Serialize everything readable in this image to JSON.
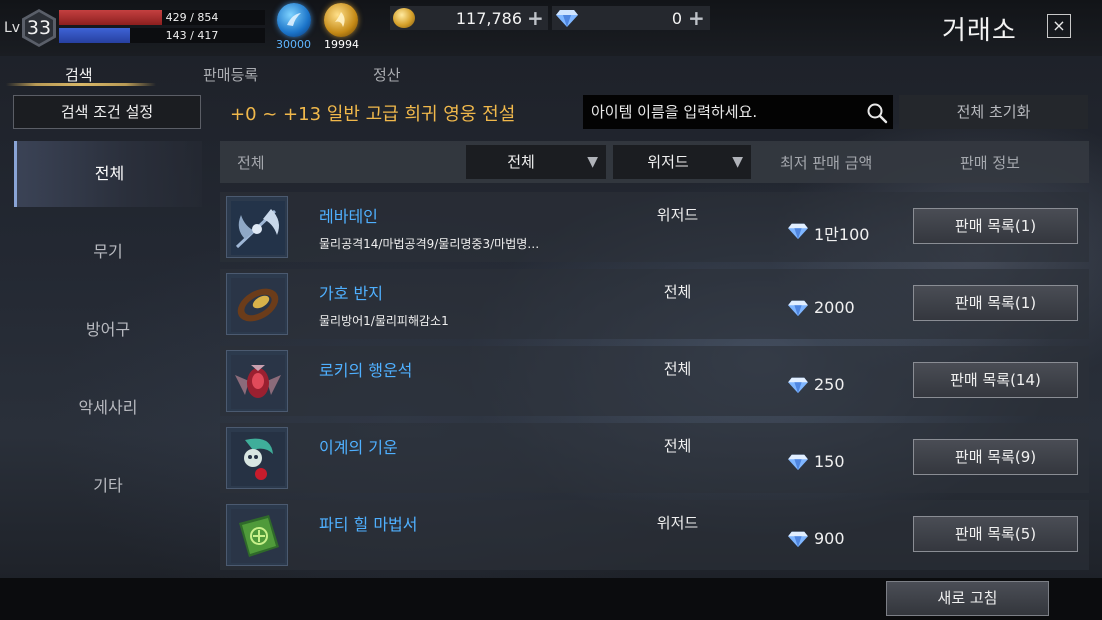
{
  "player": {
    "level_label": "Lv",
    "level": "33",
    "hp_text": "429 / 854",
    "hp_fraction": 0.502,
    "mp_text": "143 / 417",
    "mp_fraction": 0.343
  },
  "resources": {
    "blue_orb_value": "30000",
    "gold_orb_value": "19994",
    "gold": "117,786",
    "gems": "0",
    "add_symbol": "+"
  },
  "window": {
    "title": "거래소",
    "close_symbol": "×"
  },
  "tabs": {
    "search": "검색",
    "register": "판매등록",
    "settle": "정산"
  },
  "filters": {
    "condition_button": "검색 조건 설정",
    "summary": "+0 ~ +13 일반 고급 희귀 영웅 전설",
    "search_placeholder": "아이템 이름을 입력하세요.",
    "reset_button": "전체 초기화"
  },
  "sidebar": {
    "items": [
      {
        "label": "전체"
      },
      {
        "label": "무기"
      },
      {
        "label": "방어구"
      },
      {
        "label": "악세사리"
      },
      {
        "label": "기타"
      }
    ]
  },
  "list_header": {
    "category": "전체",
    "grade_dropdown": "전체",
    "class_dropdown": "위저드",
    "dropdown_arrow": "▼",
    "price": "최저 판매 금액",
    "info": "판매 정보"
  },
  "items": [
    {
      "name": "레바테인",
      "stats": "물리공격14/마법공격9/물리명중3/마법명…",
      "class": "위저드",
      "price": "1만100",
      "button": "판매 목록(1)"
    },
    {
      "name": "가호 반지",
      "stats": "물리방어1/물리피해감소1",
      "class": "전체",
      "price": "2000",
      "button": "판매 목록(1)"
    },
    {
      "name": "로키의 행운석",
      "stats": "",
      "class": "전체",
      "price": "250",
      "button": "판매 목록(14)"
    },
    {
      "name": "이계의 기운",
      "stats": "",
      "class": "전체",
      "price": "150",
      "button": "판매 목록(9)"
    },
    {
      "name": "파티 힐 마법서",
      "stats": "",
      "class": "위저드",
      "price": "900",
      "button": "판매 목록(5)"
    }
  ],
  "footer": {
    "refresh_button": "새로 고침"
  },
  "colors": {
    "accent_gold": "#f0b84b",
    "item_name_blue": "#4fb0ff",
    "hp_red": "#c44040",
    "mp_blue": "#3e63d6"
  },
  "icons": [
    "search-icon",
    "gem-icon",
    "gold-coin-icon",
    "close-icon",
    "chevron-down-icon"
  ]
}
